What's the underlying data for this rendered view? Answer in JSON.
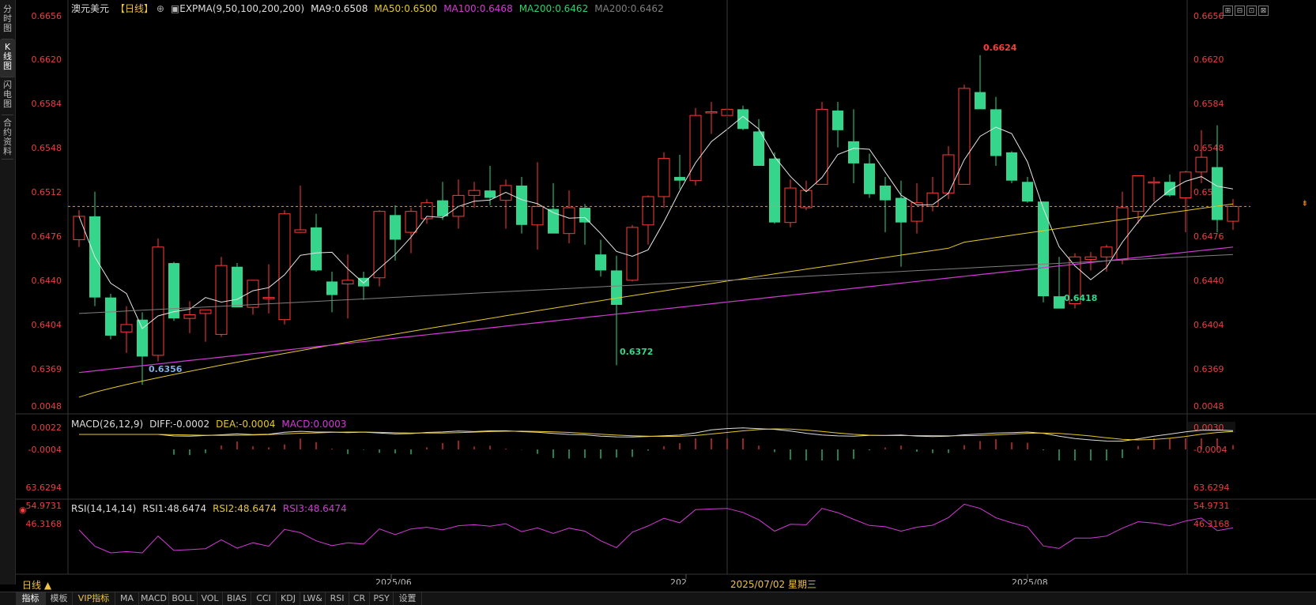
{
  "sidebar": {
    "tabs": [
      {
        "label": "分时图",
        "active": false
      },
      {
        "label": "K线图",
        "active": true
      },
      {
        "label": "闪电图",
        "active": false
      },
      {
        "label": "合约资料",
        "active": false
      }
    ]
  },
  "header": {
    "symbol": "澳元美元",
    "period_tag": "【日线】",
    "expma_label": "EXPMA(9,50,100,200,200)",
    "ma9": "MA9:0.6508",
    "ma50": "MA50:0.6500",
    "ma100": "MA100:0.6468",
    "ma200": "MA200:0.6462",
    "ma200b": "MA200:0.6462",
    "window_buttons": [
      "⊞",
      "⊟",
      "⊡",
      "⊠"
    ]
  },
  "colors": {
    "up": "#ff3b3b",
    "down": "#35d58b",
    "ma9": "#e6e6e6",
    "ma50": "#e6c92c",
    "ma100": "#d43ad8",
    "ma200": "#7f7f7f",
    "axis": "#e84040",
    "current": "#ff8a1e",
    "grid": "#222"
  },
  "price_axis": {
    "ticks": [
      "0.6656",
      "0.6620",
      "0.6584",
      "0.6548",
      "0.6512",
      "0.6476",
      "0.6440",
      "0.6404",
      "0.6369"
    ],
    "tick_values": [
      0.6656,
      0.662,
      0.6584,
      0.6548,
      0.6512,
      0.6476,
      0.644,
      0.6404,
      0.6369
    ],
    "current_price": 0.6501
  },
  "annotations": {
    "high": "0.6624",
    "low_a": "0.6356",
    "low_b": "0.6372",
    "low_c": "0.6418"
  },
  "macd": {
    "label": "MACD(26,12,9)",
    "diff": "DIFF:-0.0002",
    "dea": "DEA:-0.0004",
    "macd": "MACD:0.0003",
    "ticks": [
      "0.0048",
      "0.0022",
      "-0.0004"
    ],
    "current": "0.0030"
  },
  "rsi": {
    "label": "RSI(14,14,14)",
    "rsi1": "RSI1:48.6474",
    "rsi2": "RSI2:48.6474",
    "rsi3": "RSI3:48.6474",
    "ticks": [
      "63.6294",
      "54.9731",
      "46.3168"
    ]
  },
  "time_axis": {
    "labels": [
      "2025/06",
      "202",
      "2025/08"
    ],
    "cursor": "2025/07/02 星期三"
  },
  "period_button": "日线 ▲",
  "bottom_tabs": [
    "指标",
    "模板",
    "VIP指标",
    "MA",
    "MACD",
    "BOLL",
    "VOL",
    "BIAS",
    "CCI",
    "KDJ",
    "LW&",
    "RSI",
    "CR",
    "PSY",
    "设置"
  ],
  "chart_data": {
    "type": "candlestick",
    "ohlc": [
      [
        0.6474,
        0.6498,
        0.6468,
        0.6493
      ],
      [
        0.6493,
        0.6513,
        0.642,
        0.6427
      ],
      [
        0.6427,
        0.643,
        0.6393,
        0.6396
      ],
      [
        0.6399,
        0.642,
        0.6382,
        0.6405
      ],
      [
        0.6409,
        0.6415,
        0.6356,
        0.6379
      ],
      [
        0.638,
        0.6475,
        0.6375,
        0.6468
      ],
      [
        0.6455,
        0.6456,
        0.6408,
        0.641
      ],
      [
        0.641,
        0.6424,
        0.6398,
        0.6413
      ],
      [
        0.6414,
        0.6416,
        0.6391,
        0.6417
      ],
      [
        0.6397,
        0.646,
        0.6395,
        0.6453
      ],
      [
        0.6452,
        0.6455,
        0.6419,
        0.6419
      ],
      [
        0.6419,
        0.644,
        0.6413,
        0.6441
      ],
      [
        0.6427,
        0.6454,
        0.6414,
        0.6427
      ],
      [
        0.6409,
        0.6498,
        0.6405,
        0.6495
      ],
      [
        0.648,
        0.6518,
        0.648,
        0.6482
      ],
      [
        0.6484,
        0.6495,
        0.6448,
        0.6449
      ],
      [
        0.644,
        0.6448,
        0.6415,
        0.6429
      ],
      [
        0.6438,
        0.6462,
        0.641,
        0.6441
      ],
      [
        0.6443,
        0.6448,
        0.6425,
        0.6436
      ],
      [
        0.6443,
        0.6498,
        0.6436,
        0.6497
      ],
      [
        0.6494,
        0.6502,
        0.6457,
        0.6474
      ],
      [
        0.648,
        0.65,
        0.6463,
        0.6497
      ],
      [
        0.6491,
        0.6507,
        0.6487,
        0.6504
      ],
      [
        0.6506,
        0.6521,
        0.649,
        0.6493
      ],
      [
        0.6493,
        0.6523,
        0.6483,
        0.651
      ],
      [
        0.651,
        0.6521,
        0.65,
        0.6514
      ],
      [
        0.6514,
        0.6534,
        0.6502,
        0.6508
      ],
      [
        0.6506,
        0.6523,
        0.6483,
        0.6518
      ],
      [
        0.6518,
        0.6525,
        0.6479,
        0.6486
      ],
      [
        0.6486,
        0.6537,
        0.6466,
        0.6501
      ],
      [
        0.6499,
        0.652,
        0.648,
        0.6479
      ],
      [
        0.6479,
        0.6514,
        0.6471,
        0.65
      ],
      [
        0.65,
        0.6503,
        0.647,
        0.6488
      ],
      [
        0.6462,
        0.6474,
        0.6444,
        0.6449
      ],
      [
        0.6449,
        0.6461,
        0.6372,
        0.6421
      ],
      [
        0.6441,
        0.6486,
        0.644,
        0.6484
      ],
      [
        0.6486,
        0.651,
        0.647,
        0.6509
      ],
      [
        0.6509,
        0.6545,
        0.65,
        0.654
      ],
      [
        0.6525,
        0.6543,
        0.6515,
        0.6522
      ],
      [
        0.6522,
        0.6581,
        0.6518,
        0.6575
      ],
      [
        0.6578,
        0.6586,
        0.656,
        0.6578
      ],
      [
        0.6575,
        0.6589,
        0.6573,
        0.658
      ],
      [
        0.658,
        0.6583,
        0.6563,
        0.6564
      ],
      [
        0.6562,
        0.6572,
        0.6543,
        0.6534
      ],
      [
        0.654,
        0.6545,
        0.6487,
        0.6488
      ],
      [
        0.6488,
        0.6523,
        0.6484,
        0.6516
      ],
      [
        0.65,
        0.6522,
        0.6498,
        0.6514
      ],
      [
        0.6519,
        0.6586,
        0.6519,
        0.658
      ],
      [
        0.6579,
        0.6586,
        0.6549,
        0.6563
      ],
      [
        0.6554,
        0.658,
        0.652,
        0.6536
      ],
      [
        0.6536,
        0.6544,
        0.6508,
        0.6511
      ],
      [
        0.6518,
        0.6525,
        0.648,
        0.6506
      ],
      [
        0.6508,
        0.6522,
        0.6452,
        0.6488
      ],
      [
        0.6489,
        0.652,
        0.6479,
        0.6504
      ],
      [
        0.6501,
        0.6525,
        0.6497,
        0.6512
      ],
      [
        0.6512,
        0.655,
        0.6507,
        0.6543
      ],
      [
        0.6519,
        0.66,
        0.6519,
        0.6597
      ],
      [
        0.6594,
        0.6624,
        0.6582,
        0.658
      ],
      [
        0.658,
        0.659,
        0.6534,
        0.6542
      ],
      [
        0.6545,
        0.6546,
        0.652,
        0.6522
      ],
      [
        0.6521,
        0.6525,
        0.6504,
        0.6505
      ],
      [
        0.6505,
        0.6505,
        0.6423,
        0.6428
      ],
      [
        0.6428,
        0.646,
        0.642,
        0.6418
      ],
      [
        0.6422,
        0.6463,
        0.6418,
        0.646
      ],
      [
        0.6458,
        0.6464,
        0.6449,
        0.646
      ],
      [
        0.646,
        0.647,
        0.6448,
        0.6468
      ],
      [
        0.6458,
        0.6513,
        0.6454,
        0.65
      ],
      [
        0.6497,
        0.6525,
        0.6487,
        0.6526
      ],
      [
        0.6521,
        0.6525,
        0.6505,
        0.6521
      ],
      [
        0.6521,
        0.6527,
        0.6509,
        0.651
      ],
      [
        0.6508,
        0.653,
        0.648,
        0.6529
      ],
      [
        0.6529,
        0.6563,
        0.652,
        0.6541
      ],
      [
        0.6533,
        0.6567,
        0.648,
        0.649
      ],
      [
        0.6489,
        0.6507,
        0.6482,
        0.6501
      ]
    ],
    "y_range": [
      0.6335,
      0.666
    ]
  }
}
